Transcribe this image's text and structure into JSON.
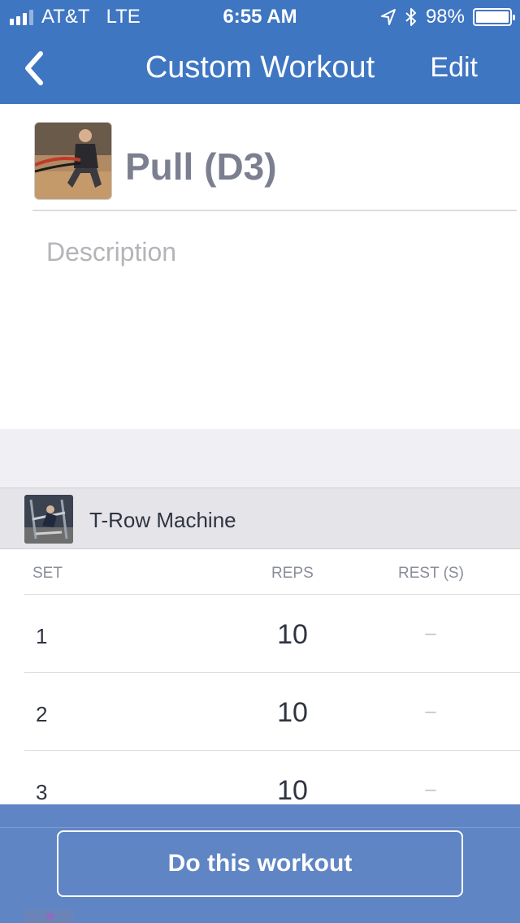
{
  "status_bar": {
    "carrier": "AT&T",
    "network": "LTE",
    "time": "6:55 AM",
    "battery": "98%"
  },
  "nav": {
    "title": "Custom Workout",
    "edit_label": "Edit",
    "back_icon": "chevron-left-icon"
  },
  "workout": {
    "name": "Pull (D3)",
    "description_placeholder": "Description"
  },
  "exercise": {
    "name": "T-Row Machine"
  },
  "table": {
    "headers": {
      "set": "SET",
      "reps": "REPS",
      "rest": "REST (S)"
    },
    "rows": [
      {
        "set": "1",
        "reps": "10",
        "rest": "–"
      },
      {
        "set": "2",
        "reps": "10",
        "rest": "–"
      },
      {
        "set": "3",
        "reps": "10",
        "rest": "–"
      }
    ]
  },
  "action": {
    "label": "Do this workout"
  },
  "colors": {
    "header": "#3f76c2",
    "bottom_bar": "#5f85c4",
    "workout_name": "#7c7f90"
  }
}
